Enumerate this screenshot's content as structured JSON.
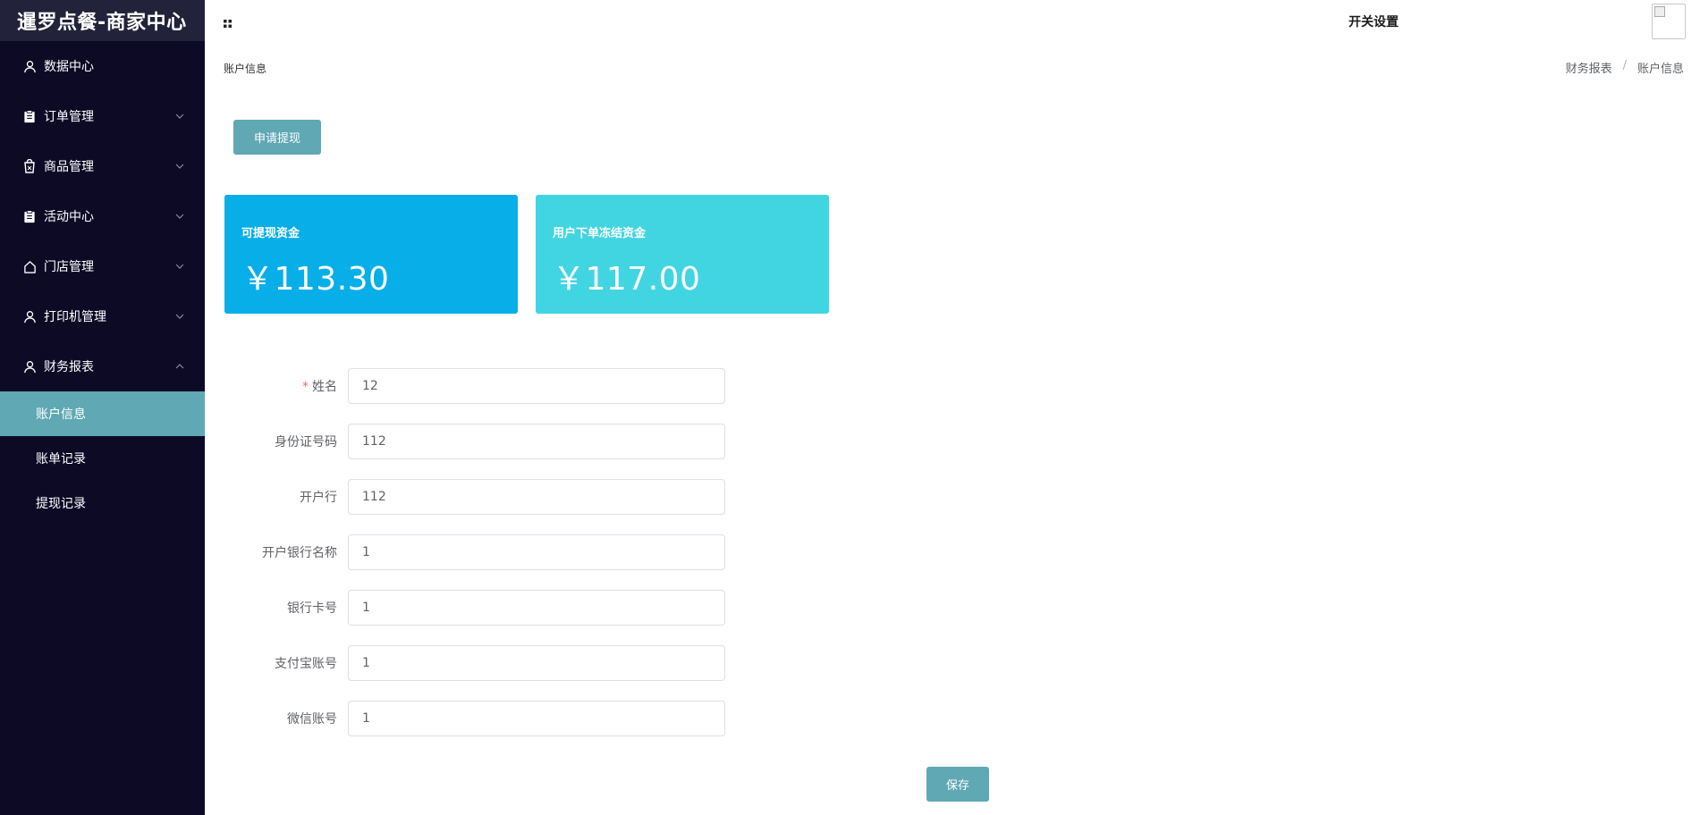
{
  "brand": "暹罗点餐-商家中心",
  "sidebar": {
    "items": [
      {
        "label": "数据中心",
        "icon": "user-icon",
        "has_arrow": false
      },
      {
        "label": "订单管理",
        "icon": "clipboard-icon",
        "has_arrow": true
      },
      {
        "label": "商品管理",
        "icon": "bag-icon",
        "has_arrow": true
      },
      {
        "label": "活动中心",
        "icon": "clipboard-icon",
        "has_arrow": true
      },
      {
        "label": "门店管理",
        "icon": "home-icon",
        "has_arrow": true
      },
      {
        "label": "打印机管理",
        "icon": "user-icon",
        "has_arrow": true
      },
      {
        "label": "财务报表",
        "icon": "user-icon",
        "has_arrow": true,
        "expanded": true
      }
    ],
    "subitems": [
      {
        "label": "账户信息",
        "active": true
      },
      {
        "label": "账单记录",
        "active": false
      },
      {
        "label": "提现记录",
        "active": false
      }
    ],
    "active_color": "#5fa8b4"
  },
  "header": {
    "menu_icon": "grid-icon",
    "title": "开关设置",
    "avatar_icon": "broken-image-icon"
  },
  "page": {
    "label": "账户信息",
    "breadcrumb": [
      "财务报表",
      "账户信息"
    ],
    "breadcrumb_separator": "/"
  },
  "actions": {
    "withdraw_label": "申请提现",
    "save_label": "保存"
  },
  "cards": [
    {
      "title": "可提现资金",
      "value": "￥113.30",
      "color": "#07aee8"
    },
    {
      "title": "用户下单冻结资金",
      "value": "￥117.00",
      "color": "#41d5e2"
    }
  ],
  "form": {
    "fields": [
      {
        "label": "姓名",
        "value": "12",
        "required": true
      },
      {
        "label": "身份证号码",
        "value": "112",
        "required": false
      },
      {
        "label": "开户行",
        "value": "112",
        "required": false
      },
      {
        "label": "开户银行名称",
        "value": "1",
        "required": false
      },
      {
        "label": "银行卡号",
        "value": "1",
        "required": false
      },
      {
        "label": "支付宝账号",
        "value": "1",
        "required": false
      },
      {
        "label": "微信账号",
        "value": "1",
        "required": false
      }
    ]
  }
}
